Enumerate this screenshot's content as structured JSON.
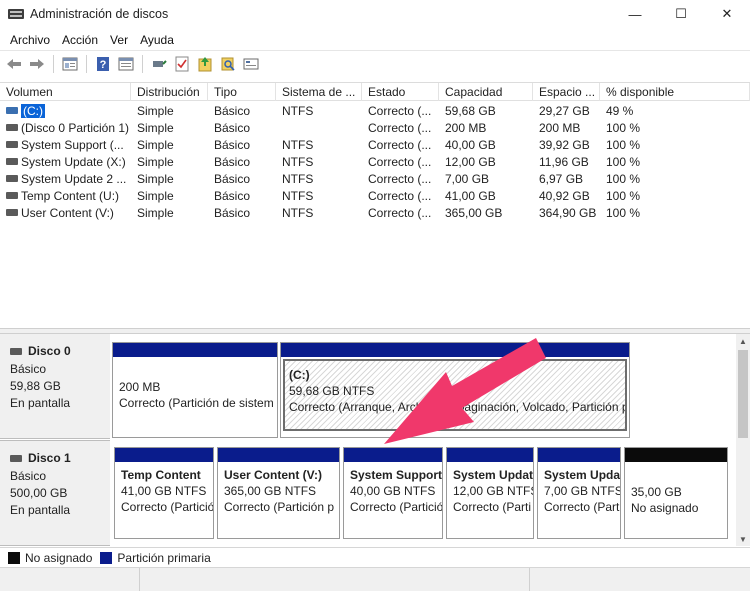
{
  "window": {
    "title": "Administración de discos",
    "minimize_glyph": "—",
    "maximize_glyph": "☐",
    "close_glyph": "✕"
  },
  "menu": [
    "Archivo",
    "Acción",
    "Ver",
    "Ayuda"
  ],
  "toolbar": {
    "icons": [
      "back-arrow-icon",
      "forward-arrow-icon",
      "properties-icon",
      "help-icon",
      "console-view-icon",
      "disk-connect-icon",
      "checklist-icon",
      "new-volume-icon",
      "search-disk-icon",
      "settings-panel-icon"
    ]
  },
  "volumes": {
    "headers": [
      "Volumen",
      "Distribución",
      "Tipo",
      "Sistema de ...",
      "Estado",
      "Capacidad",
      "Espacio ...",
      "% disponible"
    ],
    "rows": [
      {
        "name": "(C:)",
        "layout": "Simple",
        "type": "Básico",
        "fs": "NTFS",
        "status": "Correcto (...",
        "capacity": "59,68 GB",
        "free": "29,27 GB",
        "pct": "49 %"
      },
      {
        "name": "(Disco 0 Partición 1)",
        "layout": "Simple",
        "type": "Básico",
        "fs": "",
        "status": "Correcto (...",
        "capacity": "200 MB",
        "free": "200 MB",
        "pct": "100 %"
      },
      {
        "name": "System Support (...",
        "layout": "Simple",
        "type": "Básico",
        "fs": "NTFS",
        "status": "Correcto (...",
        "capacity": "40,00 GB",
        "free": "39,92 GB",
        "pct": "100 %"
      },
      {
        "name": "System Update (X:)",
        "layout": "Simple",
        "type": "Básico",
        "fs": "NTFS",
        "status": "Correcto (...",
        "capacity": "12,00 GB",
        "free": "11,96 GB",
        "pct": "100 %"
      },
      {
        "name": "System Update 2 ...",
        "layout": "Simple",
        "type": "Básico",
        "fs": "NTFS",
        "status": "Correcto (...",
        "capacity": "7,00 GB",
        "free": "6,97 GB",
        "pct": "100 %"
      },
      {
        "name": "Temp Content (U:)",
        "layout": "Simple",
        "type": "Básico",
        "fs": "NTFS",
        "status": "Correcto (...",
        "capacity": "41,00 GB",
        "free": "40,92 GB",
        "pct": "100 %"
      },
      {
        "name": "User Content (V:)",
        "layout": "Simple",
        "type": "Básico",
        "fs": "NTFS",
        "status": "Correcto (...",
        "capacity": "365,00 GB",
        "free": "364,90 GB",
        "pct": "100 %"
      }
    ]
  },
  "disks": [
    {
      "name": "Disco 0",
      "type": "Básico",
      "size": "59,88 GB",
      "state": "En pantalla",
      "partitions": [
        {
          "title": "",
          "line1": "200 MB",
          "line2": "Correcto (Partición de sistem"
        },
        {
          "title": "(C:)",
          "line1": "59,68 GB NTFS",
          "line2": "Correcto (Arranque, Archivo de paginación, Volcado, Partición p"
        }
      ]
    },
    {
      "name": "Disco 1",
      "type": "Básico",
      "size": "500,00 GB",
      "state": "En pantalla",
      "partitions": [
        {
          "title": "Temp Content",
          "line1": "41,00 GB NTFS",
          "line2": "Correcto (Partició"
        },
        {
          "title": "User Content  (V:)",
          "line1": "365,00 GB NTFS",
          "line2": "Correcto (Partición p"
        },
        {
          "title": "System Support",
          "line1": "40,00 GB NTFS",
          "line2": "Correcto (Partició"
        },
        {
          "title": "System Updat",
          "line1": "12,00 GB NTFS",
          "line2": "Correcto (Parti"
        },
        {
          "title": "System Upda",
          "line1": "7,00 GB NTFS",
          "line2": "Correcto (Parti"
        },
        {
          "title": "",
          "line1": "35,00 GB",
          "line2": "No asignado"
        }
      ]
    }
  ],
  "legend": {
    "unallocated": "No asignado",
    "primary": "Partición primaria"
  },
  "colors": {
    "primary_partition": "#0a1c8c",
    "unallocated": "#0b0b0b",
    "selection": "#0a64d8",
    "annotation_arrow": "#f0386b"
  }
}
